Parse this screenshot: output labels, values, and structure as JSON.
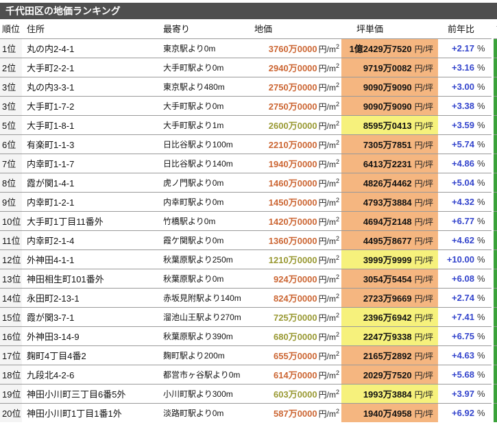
{
  "page": {
    "title": "千代田区の地価ランキング"
  },
  "colors": {
    "title_bg": "#4f4f4f",
    "title_fg": "#ffffff",
    "row_border": "#999999",
    "rank_bg": "#f4f4f4",
    "price_orange": "#cc6633",
    "price_olive": "#999933",
    "tsubo_orange_bg": "#f5b680",
    "tsubo_yellow_bg": "#f6f17c",
    "yoy_blue": "#3344cc",
    "detail_green": "#3aa23a"
  },
  "table": {
    "headers": {
      "rank": "順位",
      "address": "住所",
      "station": "最寄り",
      "price": "地価",
      "tsubo": "坪単価",
      "yoy": "前年比",
      "detail": "詳細"
    },
    "units": {
      "price_unit": "円/m",
      "price_unit_sup": "2",
      "tsubo_unit": "円/坪",
      "percent": "%"
    },
    "rows": [
      {
        "rank": "1位",
        "address": "丸の内2-4-1",
        "station": "東京駅より0m",
        "price": "3760万0000",
        "tsubo": "1億2429万7520",
        "yoy": "+2.17",
        "survey": "orange"
      },
      {
        "rank": "2位",
        "address": "大手町2-2-1",
        "station": "大手町駅より0m",
        "price": "2940万0000",
        "tsubo": "9719万0082",
        "yoy": "+3.16",
        "survey": "orange"
      },
      {
        "rank": "3位",
        "address": "丸の内3-3-1",
        "station": "東京駅より480m",
        "price": "2750万0000",
        "tsubo": "9090万9090",
        "yoy": "+3.00",
        "survey": "orange"
      },
      {
        "rank": "3位",
        "address": "大手町1-7-2",
        "station": "大手町駅より0m",
        "price": "2750万0000",
        "tsubo": "9090万9090",
        "yoy": "+3.38",
        "survey": "orange"
      },
      {
        "rank": "5位",
        "address": "大手町1-8-1",
        "station": "大手町駅より1m",
        "price": "2600万0000",
        "tsubo": "8595万0413",
        "yoy": "+3.59",
        "survey": "yellow"
      },
      {
        "rank": "6位",
        "address": "有楽町1-1-3",
        "station": "日比谷駅より100m",
        "price": "2210万0000",
        "tsubo": "7305万7851",
        "yoy": "+5.74",
        "survey": "orange"
      },
      {
        "rank": "7位",
        "address": "内幸町1-1-7",
        "station": "日比谷駅より140m",
        "price": "1940万0000",
        "tsubo": "6413万2231",
        "yoy": "+4.86",
        "survey": "orange"
      },
      {
        "rank": "8位",
        "address": "霞が関1-4-1",
        "station": "虎ノ門駅より0m",
        "price": "1460万0000",
        "tsubo": "4826万4462",
        "yoy": "+5.04",
        "survey": "orange"
      },
      {
        "rank": "9位",
        "address": "内幸町1-2-1",
        "station": "内幸町駅より0m",
        "price": "1450万0000",
        "tsubo": "4793万3884",
        "yoy": "+4.32",
        "survey": "orange"
      },
      {
        "rank": "10位",
        "address": "大手町1丁目11番外",
        "station": "竹橋駅より0m",
        "price": "1420万0000",
        "tsubo": "4694万2148",
        "yoy": "+6.77",
        "survey": "orange"
      },
      {
        "rank": "11位",
        "address": "内幸町2-1-4",
        "station": "霞ケ関駅より0m",
        "price": "1360万0000",
        "tsubo": "4495万8677",
        "yoy": "+4.62",
        "survey": "orange"
      },
      {
        "rank": "12位",
        "address": "外神田4-1-1",
        "station": "秋葉原駅より250m",
        "price": "1210万0000",
        "tsubo": "3999万9999",
        "yoy": "+10.00",
        "survey": "yellow"
      },
      {
        "rank": "13位",
        "address": "神田相生町101番外",
        "station": "秋葉原駅より0m",
        "price": "924万0000",
        "tsubo": "3054万5454",
        "yoy": "+6.08",
        "survey": "orange"
      },
      {
        "rank": "14位",
        "address": "永田町2-13-1",
        "station": "赤坂見附駅より140m",
        "price": "824万0000",
        "tsubo": "2723万9669",
        "yoy": "+2.74",
        "survey": "orange"
      },
      {
        "rank": "15位",
        "address": "霞が関3-7-1",
        "station": "溜池山王駅より270m",
        "price": "725万0000",
        "tsubo": "2396万6942",
        "yoy": "+7.41",
        "survey": "yellow"
      },
      {
        "rank": "16位",
        "address": "外神田3-14-9",
        "station": "秋葉原駅より390m",
        "price": "680万0000",
        "tsubo": "2247万9338",
        "yoy": "+6.75",
        "survey": "yellow"
      },
      {
        "rank": "17位",
        "address": "麹町4丁目4番2",
        "station": "麹町駅より200m",
        "price": "655万0000",
        "tsubo": "2165万2892",
        "yoy": "+4.63",
        "survey": "orange"
      },
      {
        "rank": "18位",
        "address": "九段北4-2-6",
        "station": "都営市ヶ谷駅より0m",
        "price": "614万0000",
        "tsubo": "2029万7520",
        "yoy": "+5.68",
        "survey": "orange"
      },
      {
        "rank": "19位",
        "address": "神田小川町三丁目6番5外",
        "station": "小川町駅より300m",
        "price": "603万0000",
        "tsubo": "1993万3884",
        "yoy": "+3.97",
        "survey": "yellow"
      },
      {
        "rank": "20位",
        "address": "神田小川町1丁目1番1外",
        "station": "淡路町駅より0m",
        "price": "587万0000",
        "tsubo": "1940万4958",
        "yoy": "+6.92",
        "survey": "orange"
      }
    ]
  }
}
